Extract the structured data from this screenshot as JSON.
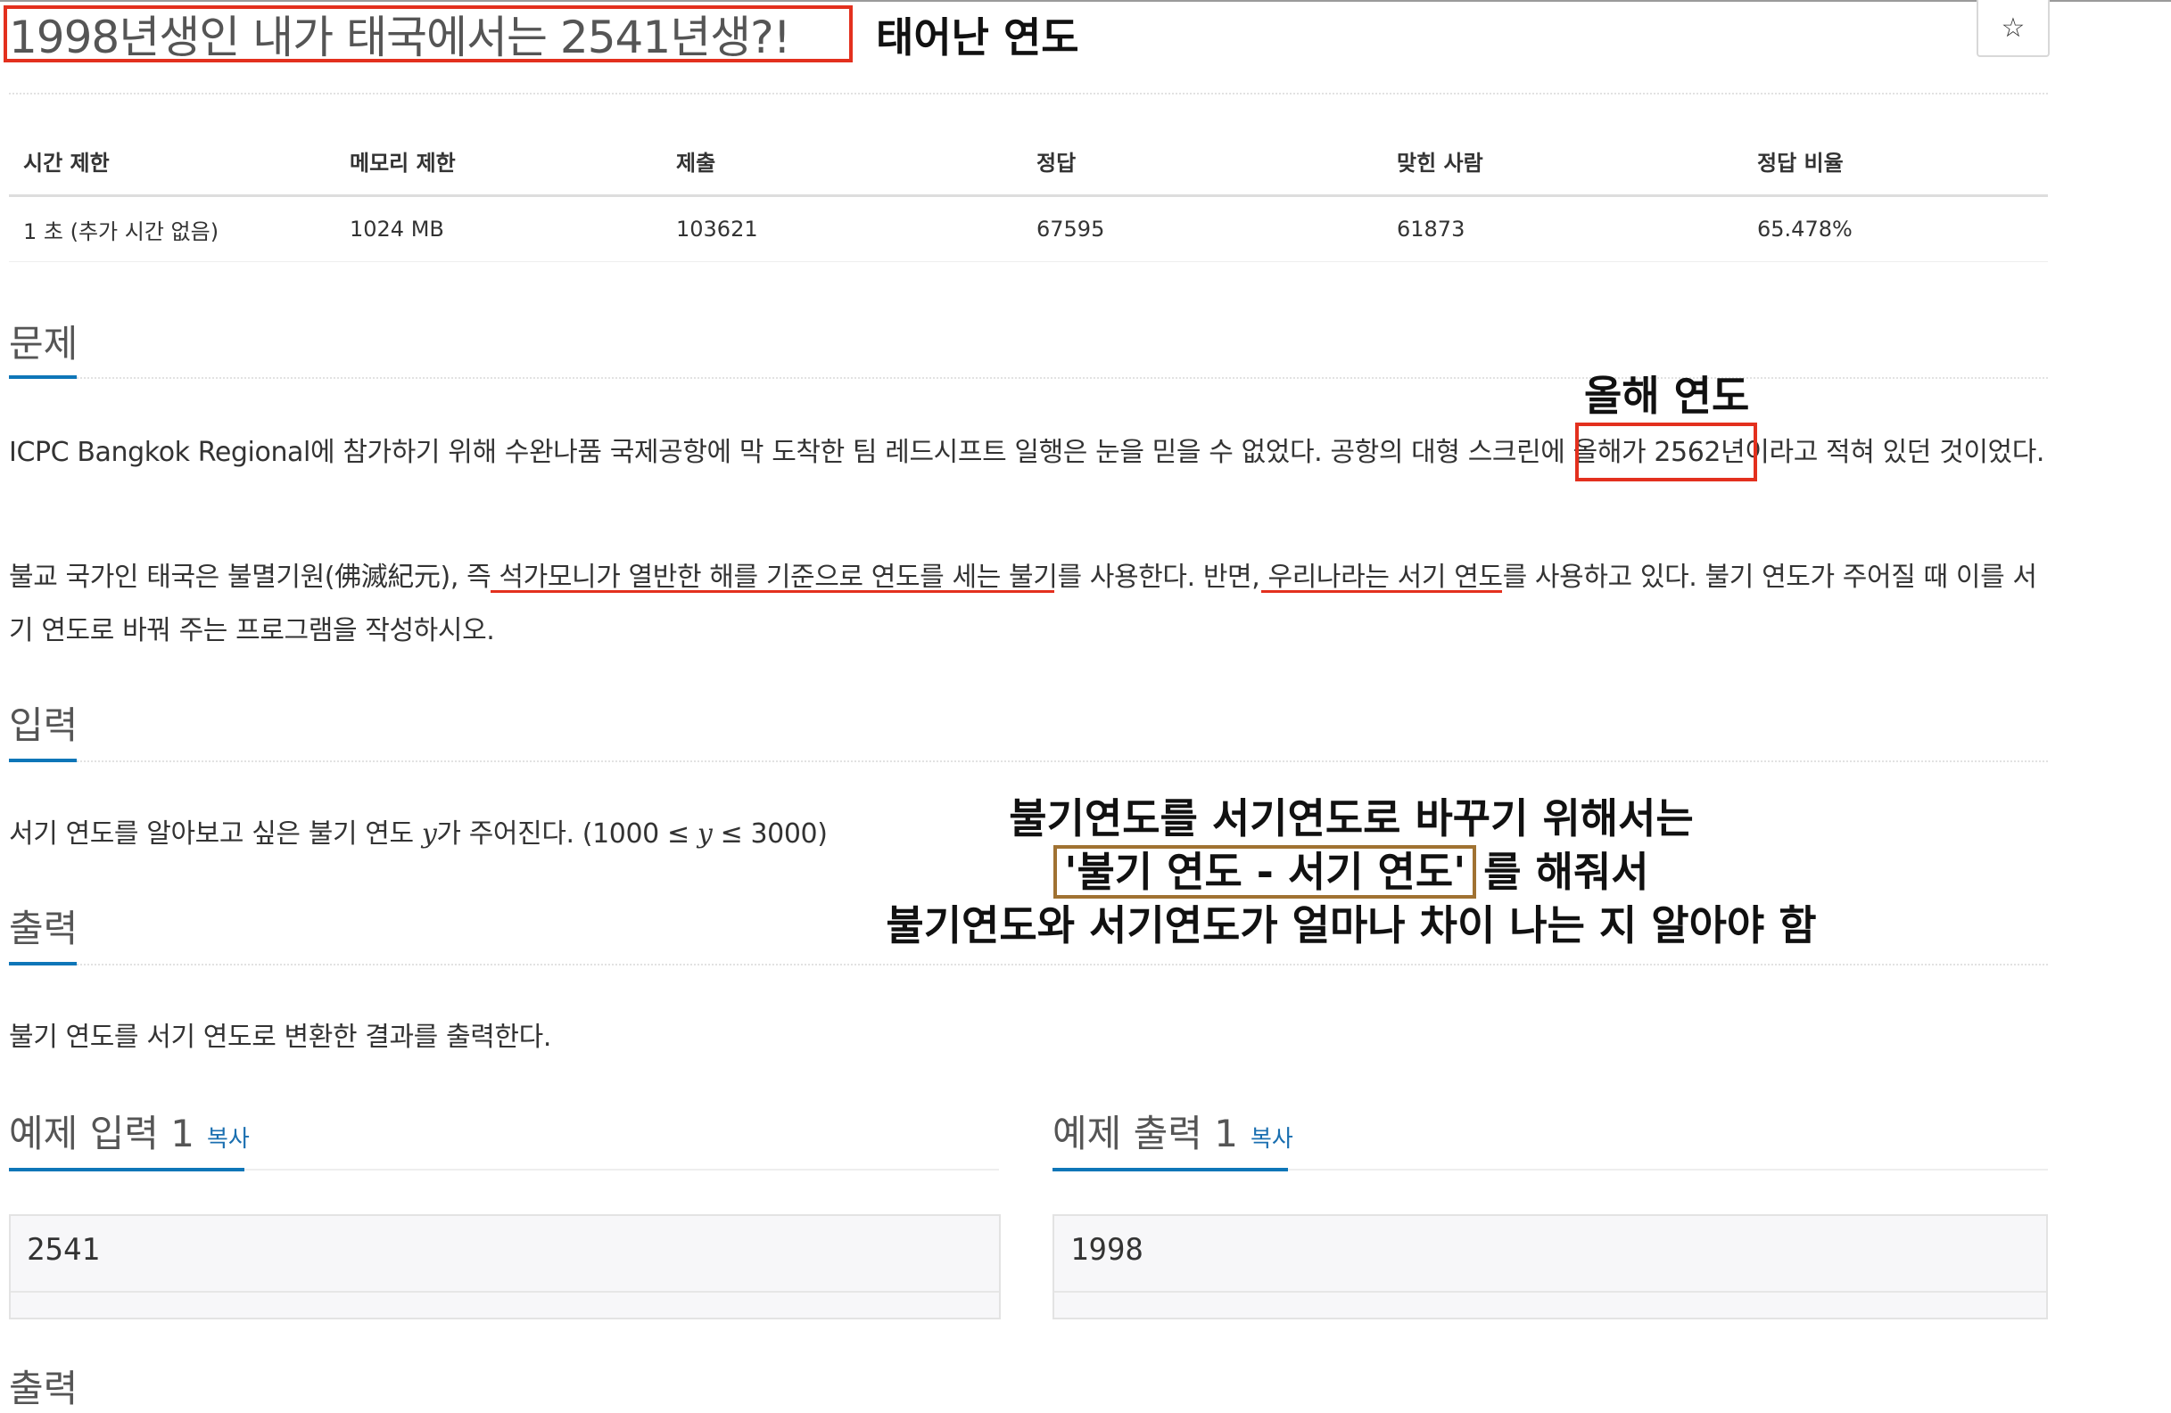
{
  "problem": {
    "title": "1998년생인 내가 태국에서는 2541년생?!",
    "star_icon": "☆"
  },
  "info_table": {
    "headers": [
      "시간 제한",
      "메모리 제한",
      "제출",
      "정답",
      "맞힌 사람",
      "정답 비율"
    ],
    "values": [
      "1 초 (추가 시간 없음)",
      "1024 MB",
      "103621",
      "67595",
      "61873",
      "65.478%"
    ]
  },
  "sections": {
    "problem": {
      "title": "문제",
      "p1": "ICPC Bangkok Regional에 참가하기 위해 수완나품 국제공항에 막 도착한 팀 레드시프트 일행은 눈을 믿을 수 없었다. 공항의 대형 스크린에 올해가 2562년이라고 적혀 있던 것이었다.",
      "p2": "불교 국가인 태국은 불멸기원(佛滅紀元), 즉 석가모니가 열반한 해를 기준으로 연도를 세는 불기를 사용한다. 반면, 우리나라는 서기 연도를 사용하고 있다. 불기 연도가 주어질 때 이를 서기 연도로 바꿔 주는 프로그램을 작성하시오."
    },
    "input": {
      "title": "입력",
      "text_before": "서기 연도를 알아보고 싶은 불기 연도 ",
      "var1": "y",
      "text_mid": "가 주어진다. (1000 ≤ ",
      "var2": "y",
      "text_after": " ≤ 3000)"
    },
    "output": {
      "title": "출력",
      "text": "불기 연도를 서기 연도로 변환한 결과를 출력한다."
    }
  },
  "samples": {
    "input_title": "예제 입력 1",
    "output_title": "예제 출력 1",
    "copy_label": "복사",
    "input_value": "2541",
    "output_value": "1998"
  },
  "annotations": {
    "birth_year": "태어난 연도",
    "this_year": "올해 연도",
    "line1": "불기연도를 서기연도로 바꾸기 위해서는",
    "line2_boxed": "'불기 연도 - 서기 연도'",
    "line2_rest": "를 해줘서",
    "line3": "불기연도와 서기연도가 얼마나 차이 나는 지 알아야 함"
  },
  "cut_off_heading": "출력"
}
